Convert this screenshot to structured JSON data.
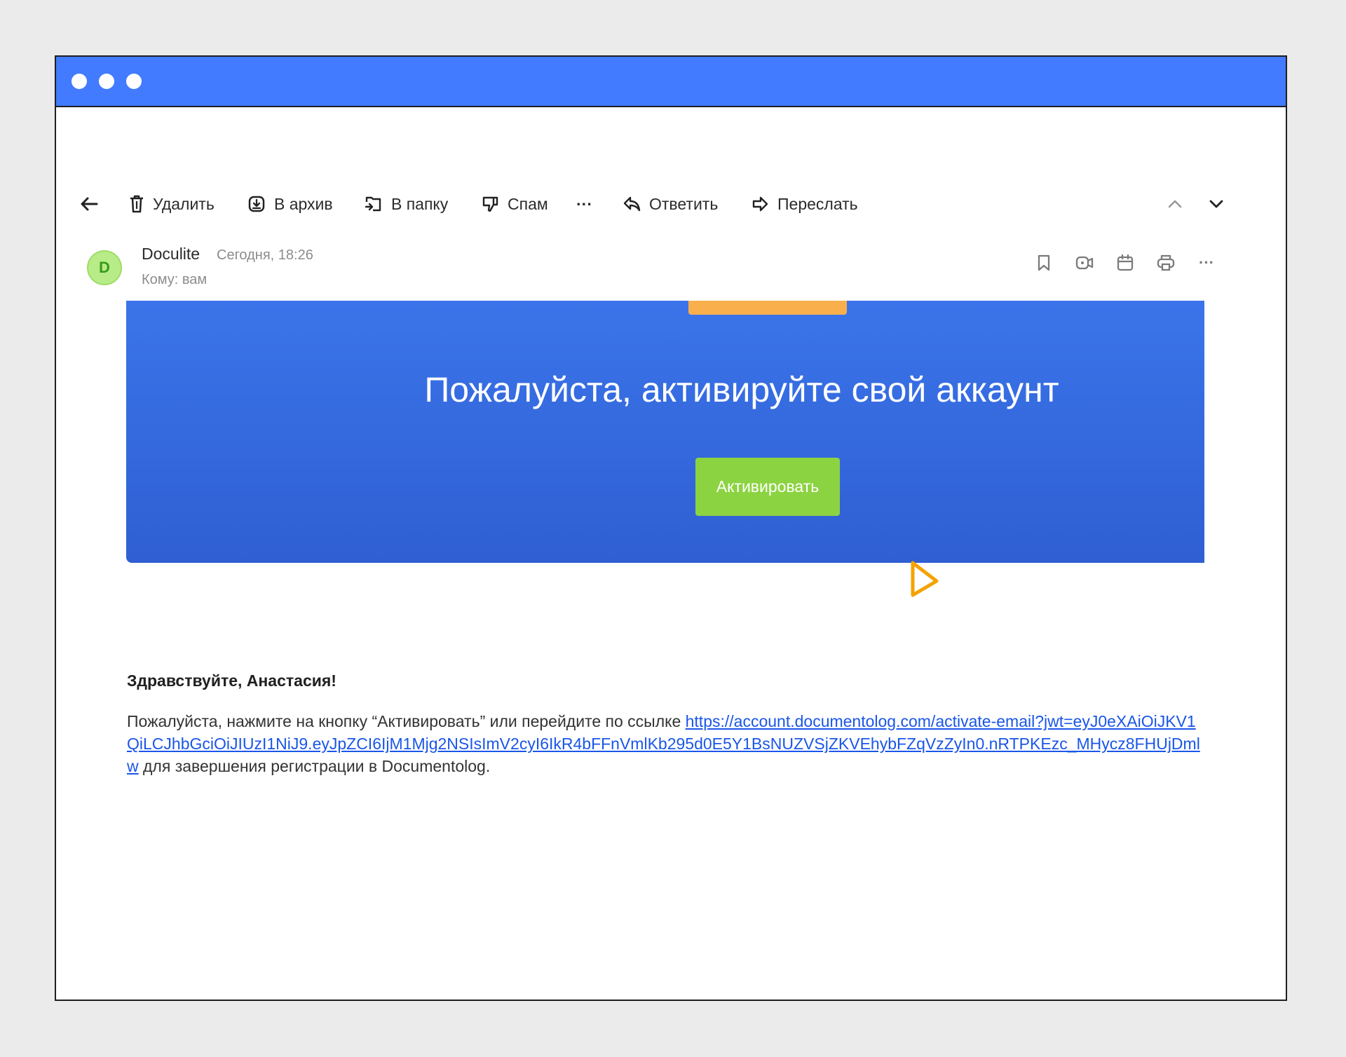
{
  "toolbar": {
    "back": "",
    "delete_label": "Удалить",
    "archive_label": "В архив",
    "folder_label": "В папку",
    "spam_label": "Спам",
    "more_label": "···",
    "reply_label": "Ответить",
    "forward_label": "Переслать"
  },
  "message": {
    "avatar_letter": "D",
    "sender": "Doculite",
    "time": "Сегодня, 18:26",
    "recipient": "Кому: вам"
  },
  "header_icons": [
    "bookmark-icon",
    "video-icon",
    "calendar-icon",
    "print-icon",
    "more-icon"
  ],
  "banner": {
    "title": "Пожалуйста, активируйте свой аккаунт",
    "button_label": "Активировать"
  },
  "body": {
    "greeting": "Здравствуйте, Анастасия!",
    "text_before": "Пожалуйста, нажмите на кнопку “Активировать” или перейдите по ссылке ",
    "link": "https://account.documentolog.com/activate-email?jwt=eyJ0eXAiOiJKV1QiLCJhbGciOiJIUzI1NiJ9.eyJpZCI6IjM1Mjg2NSIsImV2cyI6IkR4bFFnVmlKb295d0E5Y1BsNUZVSjZKVEhybFZqVzZyIn0.nRTPKEzc_MHycz8FHUjDmlw",
    "text_after": " для завершения регистрации в Documentolog."
  },
  "colors": {
    "titlebar": "#427bff",
    "banner": "#3b74ea",
    "button": "#8cd341",
    "cursor": "#f4a200",
    "link": "#1a56e8"
  }
}
